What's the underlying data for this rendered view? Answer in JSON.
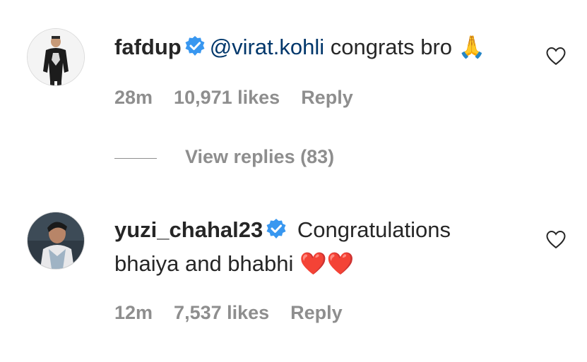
{
  "comments": [
    {
      "username": "fafdup",
      "mention": "@virat.kohli",
      "text": " congrats bro ",
      "emoji": "🙏",
      "time": "28m",
      "likes": "10,971 likes",
      "reply_label": "Reply",
      "view_replies": "View replies (83)"
    },
    {
      "username": "yuzi_chahal23",
      "text_line1": " Congratulations",
      "text_line2": "bhaiya and bhabhi ",
      "emoji": "❤️❤️",
      "time": "12m",
      "likes": "7,537 likes",
      "reply_label": "Reply"
    }
  ],
  "colors": {
    "verified": "#3897f0",
    "mention": "#00376b",
    "meta": "#8e8e8e",
    "heart_emoji": "#e0245e"
  },
  "icons": [
    "verified-badge-icon",
    "heart-outline-icon",
    "folded-hands-emoji",
    "red-heart-emoji"
  ]
}
